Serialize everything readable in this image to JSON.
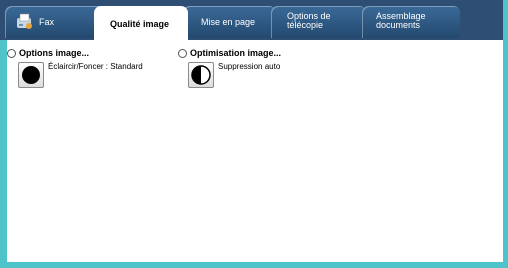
{
  "tabs": [
    {
      "label": "Fax"
    },
    {
      "label": "Qualité image"
    },
    {
      "label": "Mise en page"
    },
    {
      "label": "Options de télécopie"
    },
    {
      "label": "Assemblage documents"
    }
  ],
  "options_image": {
    "header": "Options image...",
    "button_label": "Éclaircir/Foncer : Standard"
  },
  "optimisation_image": {
    "header": "Optimisation image...",
    "button_label": "Suppression auto"
  },
  "colors": {
    "tab_bar": "#2e4f73",
    "accent": "#4ec3c9"
  }
}
